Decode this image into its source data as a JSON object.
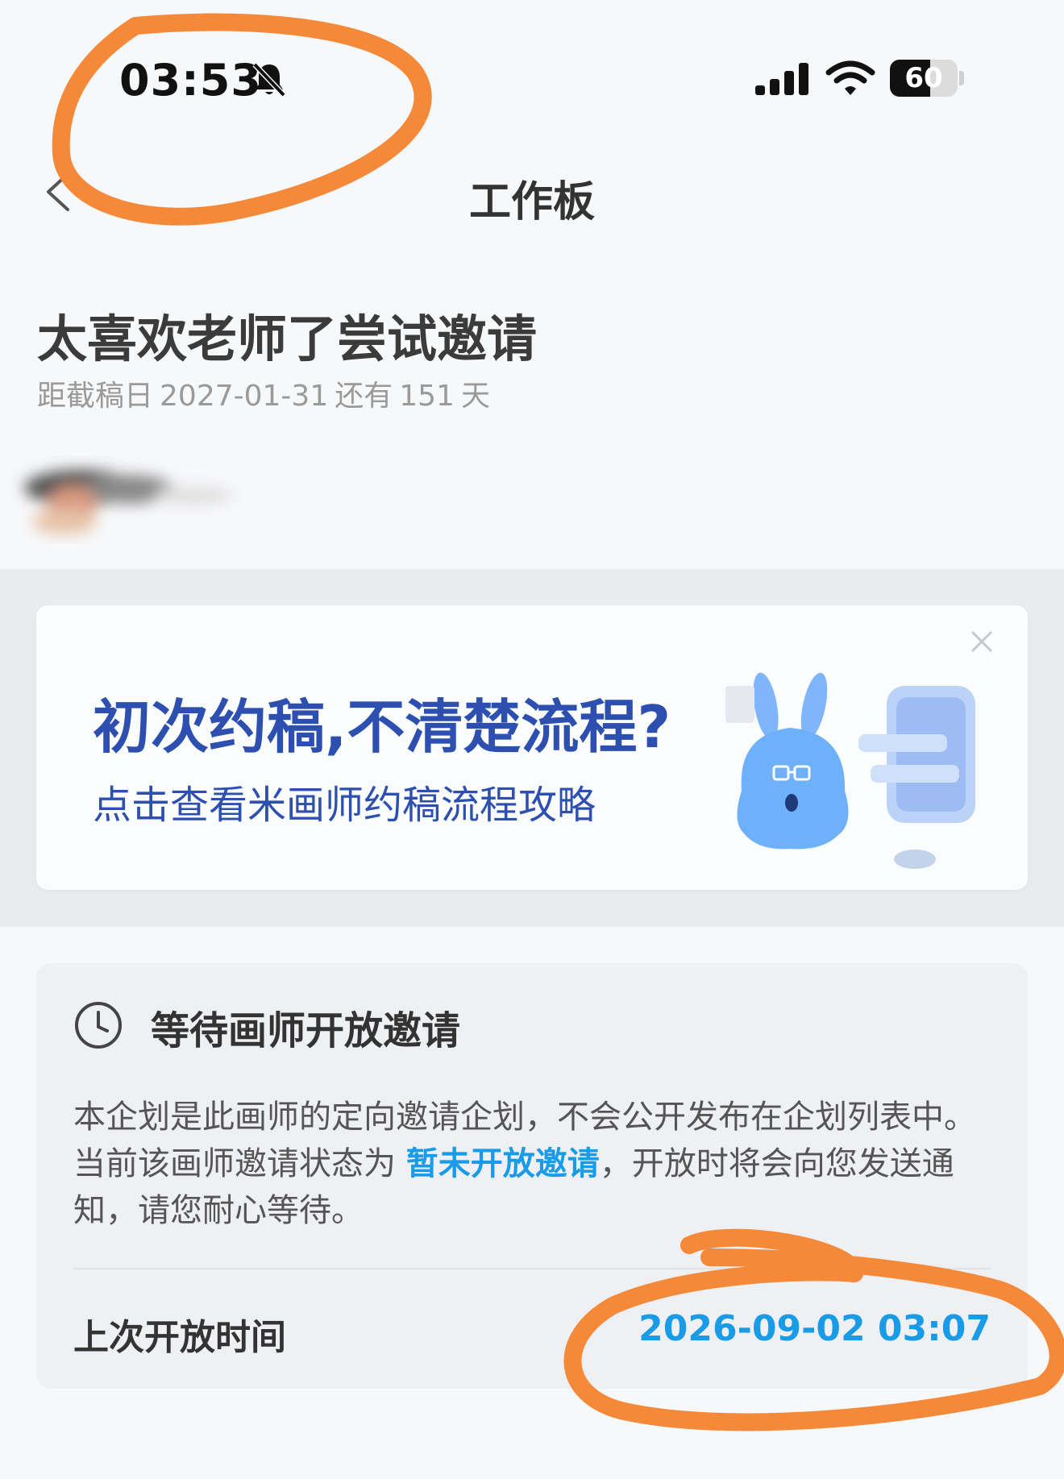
{
  "status_bar": {
    "time": "03:53",
    "battery_level": 60,
    "battery_text": "60",
    "icons": [
      "bell-slash-icon",
      "cellular-signal-icon",
      "wifi-icon",
      "battery-icon"
    ]
  },
  "nav": {
    "title": "工作板",
    "back_icon": "chevron-left-icon"
  },
  "project": {
    "title": "太喜欢老师了尝试邀请",
    "deadline_prefix": "距截稿日",
    "deadline_date": "2027-01-31",
    "deadline_mid": "还有",
    "days_left": "151",
    "days_unit": "天"
  },
  "banner": {
    "title": "初次约稿,不清楚流程?",
    "subtitle": "点击查看米画师约稿流程攻略",
    "close_icon": "close-icon"
  },
  "wait_card": {
    "icon": "clock-icon",
    "title": "等待画师开放邀请",
    "body_before": "本企划是此画师的定向邀请企划，不会公开发布在企划列表中。当前该画师邀请状态为 ",
    "status_highlight": "暂未开放邀请",
    "body_after": "，开放时将会向您发送通知，请您耐心等待。",
    "last_open_label": "上次开放时间",
    "last_open_value": "2026-09-02 03:07"
  },
  "colors": {
    "accent_blue": "#1a9be8",
    "banner_blue": "#2c4fb0",
    "annotation_orange": "#f5893a",
    "background": "#f7f8fa",
    "band": "#e9ebef"
  }
}
